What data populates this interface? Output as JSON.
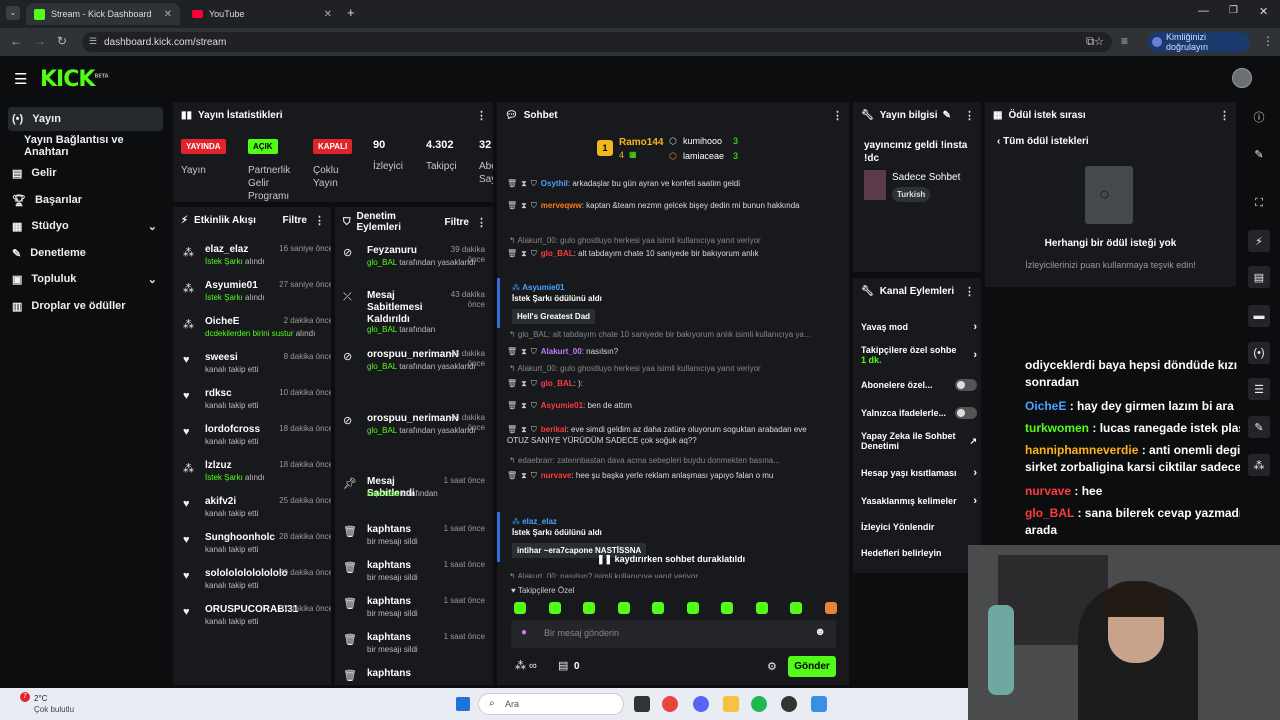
{
  "browser": {
    "tabs": [
      {
        "title": "Stream - Kick Dashboard",
        "active": true
      },
      {
        "title": "YouTube",
        "active": false
      }
    ],
    "url": "dashboard.kick.com/stream",
    "verify_label": "Kimliğinizi doğrulayın"
  },
  "brand": {
    "logo": "KICK",
    "beta": "BETA",
    "accent": "#53fc18"
  },
  "sidebar": {
    "items": [
      {
        "label": "Yayın",
        "icon": "broadcast-icon"
      },
      {
        "label": "Yayın Bağlantısı ve Anahtarı",
        "icon": ""
      },
      {
        "label": "Gelir",
        "icon": "wallet-icon"
      },
      {
        "label": "Başarılar",
        "icon": "trophy-icon"
      },
      {
        "label": "Stüdyo",
        "icon": "studio-icon"
      },
      {
        "label": "Denetleme",
        "icon": "wrench-icon"
      },
      {
        "label": "Topluluk",
        "icon": "community-icon"
      },
      {
        "label": "Droplar ve ödüller",
        "icon": "gift-icon"
      }
    ]
  },
  "stats": {
    "title": "Yayın İstatistikleri",
    "live_badge": "YAYINDA",
    "live_label": "Yayın",
    "partner_badge": "AÇIK",
    "partner_label": "Partnerlik Gelir Programı",
    "multi_badge": "KAPALI",
    "multi_label": "Çoklu Yayın",
    "viewers": "90",
    "viewers_label": "İzleyici",
    "followers": "4.302",
    "followers_label": "Takipçi",
    "subs": "32",
    "subs_label": "Abo Say"
  },
  "activity": {
    "title": "Etkinlik Akışı",
    "filter": "Filtre",
    "items": [
      {
        "name": "elaz_elaz",
        "time": "16 saniye önce",
        "sub": "İstek Şarkı",
        "sub2": "alındı",
        "icon": "points-icon"
      },
      {
        "name": "Asyumie01",
        "time": "27 saniye önce",
        "sub": "İstek Şarkı",
        "sub2": "alındı",
        "icon": "points-icon"
      },
      {
        "name": "OicheE",
        "time": "2 dakika önce",
        "sub": "dcdekilerden birini sustur",
        "sub2": "alındı",
        "icon": "points-icon"
      },
      {
        "name": "sweesi",
        "time": "8 dakika önce",
        "sub": "",
        "sub2": "kanalı takip etti",
        "icon": "heart-icon"
      },
      {
        "name": "rdksc",
        "time": "10 dakika önce",
        "sub": "",
        "sub2": "kanalı takip etti",
        "icon": "heart-icon"
      },
      {
        "name": "lordofcross",
        "time": "18 dakika önce",
        "sub": "",
        "sub2": "kanalı takip etti",
        "icon": "heart-icon"
      },
      {
        "name": "lzlzuz",
        "time": "18 dakika önce",
        "sub": "İstek Şarkı",
        "sub2": "alındı",
        "icon": "points-icon"
      },
      {
        "name": "akifv2i",
        "time": "25 dakika önce",
        "sub": "",
        "sub2": "kanalı takip etti",
        "icon": "heart-icon"
      },
      {
        "name": "Sunghoonholc",
        "time": "28 dakika önce",
        "sub": "",
        "sub2": "kanalı takip etti",
        "icon": "heart-icon"
      },
      {
        "name": "sololololololololo",
        "time": "29 dakika önce",
        "sub": "",
        "sub2": "kanalı takip etti",
        "icon": "heart-icon"
      },
      {
        "name": "ORUSPUCORABI31",
        "time": "37 dakika önce",
        "sub": "",
        "sub2": "kanalı takip etti",
        "icon": "heart-icon"
      }
    ]
  },
  "moderation": {
    "title": "Denetim Eylemleri",
    "filter": "Filtre",
    "items": [
      {
        "name": "Feyzanuru",
        "time": "39 dakika önce",
        "by": "glo_BAL",
        "action": "tarafından yasaklandı",
        "icon": "ban-icon"
      },
      {
        "name": "Mesaj Sabitlemesi Kaldırıldı",
        "time": "43 dakika önce",
        "by": "glo_BAL",
        "action": "tarafından",
        "icon": "unpin-icon"
      },
      {
        "name": "orospuu_nerimanN",
        "time": "43 dakika önce",
        "by": "glo_BAL",
        "action": "tarafından yasaklandı",
        "icon": "ban-icon"
      },
      {
        "name": "orospuu_nerimanN",
        "time": "44 dakika önce",
        "by": "glo_BAL",
        "action": "tarafından yasaklandı",
        "icon": "ban-icon"
      },
      {
        "name": "Mesaj Sabitlendi",
        "time": "1 saat önce",
        "by": "kaphtans",
        "action": "tarafından",
        "icon": "pin-icon"
      },
      {
        "name": "kaphtans",
        "time": "1 saat önce",
        "by": "",
        "action": "bir mesajı sildi",
        "icon": "trash-icon"
      },
      {
        "name": "kaphtans",
        "time": "1 saat önce",
        "by": "",
        "action": "bir mesajı sildi",
        "icon": "trash-icon"
      },
      {
        "name": "kaphtans",
        "time": "1 saat önce",
        "by": "",
        "action": "bir mesajı sildi",
        "icon": "trash-icon"
      },
      {
        "name": "kaphtans",
        "time": "1 saat önce",
        "by": "",
        "action": "bir mesajı sildi",
        "icon": "trash-icon"
      },
      {
        "name": "kaphtans",
        "time": "",
        "by": "",
        "action": "",
        "icon": "trash-icon"
      }
    ]
  },
  "chat": {
    "title": "Sohbet",
    "top_gifter": {
      "name": "Ramo144",
      "count": "4",
      "rank": "1"
    },
    "gifters": [
      {
        "name": "kumihooo",
        "count": "3"
      },
      {
        "name": "lamiaceae",
        "count": "3"
      }
    ],
    "lines": [
      {
        "user": "Osythil",
        "color": "#4aa3ff",
        "text": "arkadaşlar bu gün ayran ve konfeti saatim geldi"
      },
      {
        "user": "merveqww",
        "color": "#ff7a1a",
        "text": "kaptan &team nezmn gelcek bişey dedin mi bunun hakkında"
      },
      {
        "reply": "Alakurt_00: gulo ghostluyo herkesi yaa isimli kullanıcıya yanıt veriyor"
      },
      {
        "user": "glo_BAL",
        "color": "#ff3b3b",
        "text": "alt tabdayım chate 10 saniyede bir bakıyorum anlık"
      },
      {
        "user": "Asyumie01",
        "color": "#4aa3ff",
        "text": "İstek Şarkı ödülünü aldı",
        "highlight": "Hell's Greatest Dad"
      },
      {
        "reply": "glo_BAL: alt tabdayım chate 10 saniyede bir bakıyorum anlık isimli kullanıcıya ya..."
      },
      {
        "user": "Alakurt_00",
        "color": "#c67aff",
        "text": "nasılsın?"
      },
      {
        "reply": "Alakurt_00: gulo ghostluyo herkesi yaa isimli kullanıcıya yanıt veriyor"
      },
      {
        "user": "glo_BAL",
        "color": "#ff3b3b",
        "text": "):"
      },
      {
        "user": "Asyumie01",
        "color": "#ff3b3b",
        "text": "ben de attım"
      },
      {
        "user": "berikal",
        "color": "#ff3b3b",
        "text": "eve simdi geldim az daha zatüre oluyorum soguktan arabadan eve OTUZ SANİYE YÜRÜDÜM SADECE çok soğuk aq??"
      },
      {
        "reply": "edaebrarr: zatennbastan dava acma sebepleri buydu donmekten basına..."
      },
      {
        "user": "nurvave",
        "color": "#ff3b3b",
        "text": "hee şu başka yerle reklam anlaşması yapıyo falan o mu"
      },
      {
        "user": "elaz_elaz",
        "color": "#4aa3ff",
        "text": "İstek Şarkı ödülünü aldı",
        "highlight": "intihar ~era7capone NASTİSSNA"
      },
      {
        "reply": "Alakurt_00: nasılsın? isimli kullanıcıya yanıt veriyor"
      }
    ],
    "paused": "kaydırırken sohbet duraklatıldı",
    "followers_only": "Takipçilere Özel",
    "input_placeholder": "Bir mesaj gönderin",
    "points": "0",
    "send": "Gönder"
  },
  "stream_info": {
    "title": "Yayın bilgisi",
    "stream_title": "yayıncınız geldi !insta !dc",
    "category": "Sadece Sohbet",
    "tag": "Turkish"
  },
  "channel_actions": {
    "title": "Kanal Eylemleri",
    "items": [
      {
        "label": "Yavaş mod",
        "control": "chevron"
      },
      {
        "label": "Takipçilere özel sohbe",
        "extra": "1 dk.",
        "control": "chevron"
      },
      {
        "label": "Abonelere özel...",
        "control": "toggle"
      },
      {
        "label": "Yalnızca ifadelerle...",
        "control": "toggle"
      },
      {
        "label": "Yapay Zeka ile Sohbet Denetimi",
        "control": "external"
      },
      {
        "label": "Hesap yaşı kısıtlaması",
        "control": "chevron"
      },
      {
        "label": "Yasaklanmış kelimeler",
        "control": "chevron"
      },
      {
        "label": "İzleyici Yönlendir",
        "control": ""
      },
      {
        "label": "Hedefleri belirleyin",
        "control": ""
      }
    ]
  },
  "rewards": {
    "title": "Ödül istek sırası",
    "back": "Tüm ödül istekleri",
    "empty_title": "Herhangi bir ödül isteği yok",
    "empty_sub": "İzleyicilerinizi puan kullanmaya teşvik edin!"
  },
  "overlay_chat": [
    {
      "user": "",
      "text": "odiyceklerdi baya hepsi döndüde kızı attılar sonradan"
    },
    {
      "user": "OicheE",
      "color": "#4aa3ff",
      "text": "hay dey girmen lazım bi ara"
    },
    {
      "user": "turkwomen",
      "color": "#53fc18",
      "text": "lucas ranegade istek plase"
    },
    {
      "user": "hanniphamneverdie",
      "color": "#ffb21a",
      "text": "anti onemli degilki sirket zorbaligina karsi ciktilar sadece"
    },
    {
      "user": "nurvave",
      "color": "#ff3b3b",
      "text": "hee"
    },
    {
      "user": "glo_BAL",
      "color": "#ff3b3b",
      "text": "sana bilerek cevap yazmadım bu arada"
    }
  ],
  "taskbar": {
    "weather_temp": "2°C",
    "weather_desc": "Çok bulutlu",
    "search": "Ara",
    "weather_badge": "7"
  }
}
